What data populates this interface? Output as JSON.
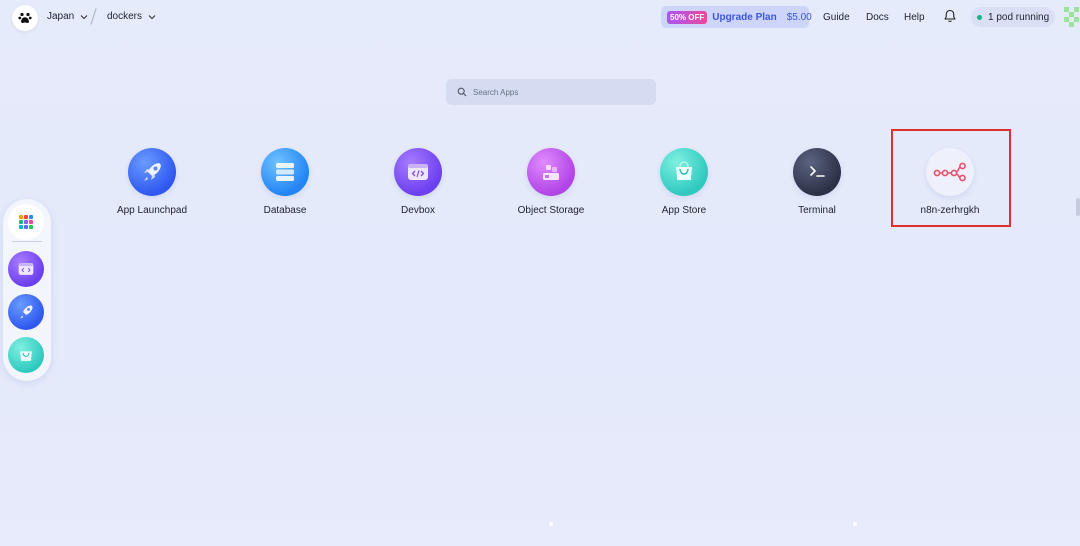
{
  "header": {
    "region": "Japan",
    "workspace": "dockers",
    "upgrade": {
      "badge": "50% OFF",
      "label": "Upgrade Plan",
      "price": "$5.00"
    },
    "nav": [
      "Guide",
      "Docs",
      "Help"
    ],
    "pod_status": "1 pod running"
  },
  "search": {
    "placeholder": "Search Apps"
  },
  "apps": [
    {
      "label": "App Launchpad",
      "icon": "rocket-icon"
    },
    {
      "label": "Database",
      "icon": "database-icon"
    },
    {
      "label": "Devbox",
      "icon": "devbox-icon"
    },
    {
      "label": "Object Storage",
      "icon": "object-storage-icon"
    },
    {
      "label": "App Store",
      "icon": "shopping-bag-icon"
    },
    {
      "label": "Terminal",
      "icon": "terminal-icon"
    },
    {
      "label": "n8n-zerhrgkh",
      "icon": "n8n-icon"
    }
  ],
  "dock": [
    "apps-grid-icon",
    "devbox-icon",
    "rocket-icon",
    "shopping-bag-icon"
  ],
  "colors": {
    "accent": "#3b56e0",
    "highlight": "#e03131",
    "status_ok": "#10b981"
  }
}
